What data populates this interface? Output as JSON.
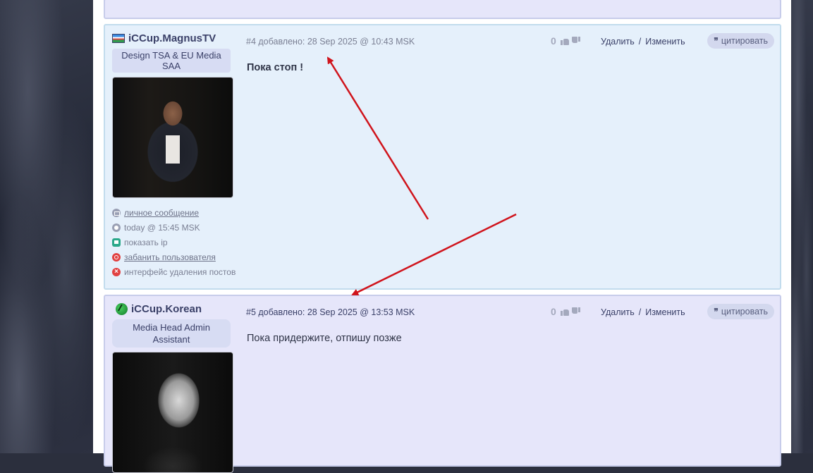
{
  "posts": [
    {
      "author": "iCCup.MagnusTV",
      "rank": "Design TSA & EU Media SAA",
      "number": "#4 добавлено: 28 Sep 2025 @ 10:43 MSK",
      "rating": "0",
      "delete_label": "Удалить",
      "separator": "/",
      "edit_label": "Изменить",
      "quote_label": "цитировать",
      "body": "Пока стоп !",
      "meta": {
        "message": "личное сообщение",
        "last_seen": "today @ 15:45 MSK",
        "show_ip": "показать ip",
        "ban": "забанить пользователя",
        "delete_posts": "интерфейс удаления постов"
      }
    },
    {
      "author": "iCCup.Korean",
      "rank": "Media Head Admin Assistant",
      "number": "#5 добавлено: 28 Sep 2025 @ 13:53 MSK",
      "rating": "0",
      "delete_label": "Удалить",
      "separator": "/",
      "edit_label": "Изменить",
      "quote_label": "цитировать",
      "body": "Пока придержите, отпишу позже"
    }
  ],
  "colors": {
    "arrow": "#d0141c",
    "post_highlight_bg": "#e5f0fb",
    "post_bg": "#e6e6fa",
    "quote_bg": "#d3d8ee",
    "text_dark": "#3a4068"
  }
}
